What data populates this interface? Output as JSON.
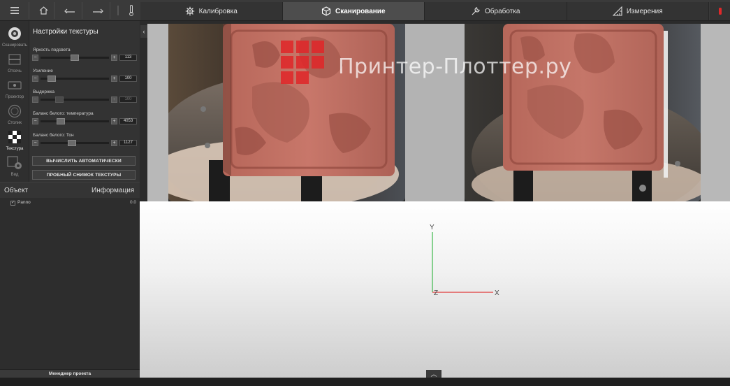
{
  "colors": {
    "accent_red": "#e0282a",
    "panel_bg": "#333333",
    "topbar_bg": "#3a3a3a",
    "tab_active_bg": "#4d4d4d",
    "axis_x": "#e03b3b",
    "axis_y": "#3cb84a"
  },
  "tabs": [
    {
      "label": "Калибровка",
      "icon": "gear-icon"
    },
    {
      "label": "Сканирование",
      "icon": "cube-icon",
      "active": true
    },
    {
      "label": "Обработка",
      "icon": "wrench-icon"
    },
    {
      "label": "Измерения",
      "icon": "ruler-triangle-icon"
    }
  ],
  "nav": [
    {
      "label": "Сканировать",
      "icon": "aperture-icon"
    },
    {
      "label": "Отсечь",
      "icon": "cut-plane-icon"
    },
    {
      "label": "Проектор",
      "icon": "projector-icon"
    },
    {
      "label": "Столик",
      "icon": "turntable-icon"
    },
    {
      "label": "Текстура",
      "icon": "checker-texture-icon",
      "active": true
    },
    {
      "label": "Вид",
      "icon": "view-icon"
    }
  ],
  "settings": {
    "title": "Настройки текстуры",
    "sliders": [
      {
        "label": "Яркость подсвета",
        "value": "113",
        "position": 0.5
      },
      {
        "label": "Усиление",
        "value": "100",
        "position": 0.12
      },
      {
        "label": "Выдержка",
        "value": "100",
        "position": 0.24,
        "disabled": true
      },
      {
        "label": "Баланс белого: температура",
        "value": "4053",
        "position": 0.27
      },
      {
        "label": "Баланс белого: Тон",
        "value": "1127",
        "position": 0.45
      }
    ],
    "auto_button": "ВЫЧИСЛИТЬ АВТОМАТИЧЕСКИ",
    "snapshot_button": "ПРОБНЫЙ СНИМОК ТЕКСТУРЫ"
  },
  "object_panel": {
    "col_object": "Объект",
    "col_info": "Информация",
    "rows": [
      {
        "name": "Panno",
        "value": "0.0"
      }
    ]
  },
  "project_manager": "Менеджер проекта",
  "axes": {
    "x": "X",
    "y": "Y",
    "z": "Z"
  },
  "watermark": "Принтер-Плоттер.ру"
}
